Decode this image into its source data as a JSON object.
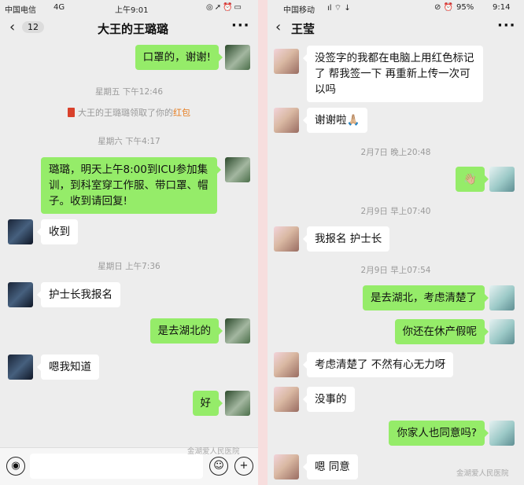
{
  "left": {
    "status": {
      "carrier": "中国电信",
      "network": "4G",
      "time": "上午9:01"
    },
    "nav": {
      "back_count": "12",
      "title": "大王的王璐璐",
      "more": "···"
    },
    "timestamps": [
      "星期五 下午12:46",
      "星期六 下午4:17",
      "星期日 上午7:36"
    ],
    "system_notice": {
      "text": "大王的王璐璐领取了你的",
      "link": "红包"
    },
    "messages": [
      "口罩的，谢谢!",
      "璐璐，明天上午8:00到ICU参加集训，到科室穿工作服、带口罩、帽子。收到请回复!",
      "收到",
      "护士长我报名",
      "是去湖北的",
      "嗯我知道",
      "好"
    ],
    "input": {
      "voice_icon": "voice-icon",
      "emoji_icon": "emoji-icon",
      "plus_icon": "plus-icon"
    },
    "watermark": "金湖爱人民医院"
  },
  "right": {
    "status": {
      "carrier": "中国移动",
      "battery": "95%",
      "time": "9:14"
    },
    "nav": {
      "title": "王莹",
      "more": "···"
    },
    "timestamps": [
      "2月7日 晚上20:48",
      "2月9日 早上07:40",
      "2月9日 早上07:54"
    ],
    "messages": [
      "没签字的我都在电脑上用红色标记了 帮我签一下 再重新上传一次可以吗",
      "谢谢啦🙏🏼",
      "👋🏼",
      "我报名 护士长",
      "是去湖北，考虑清楚了",
      "你还在休产假呢",
      "考虑清楚了 不然有心无力呀",
      "没事的",
      "你家人也同意吗?",
      "嗯 同意"
    ],
    "watermark": "金湖爱人民医院"
  },
  "colors": {
    "outgoing_bubble": "#95ec69",
    "incoming_bubble": "#ffffff",
    "chat_bg": "#ededed",
    "red_packet_link": "#e67e22"
  }
}
